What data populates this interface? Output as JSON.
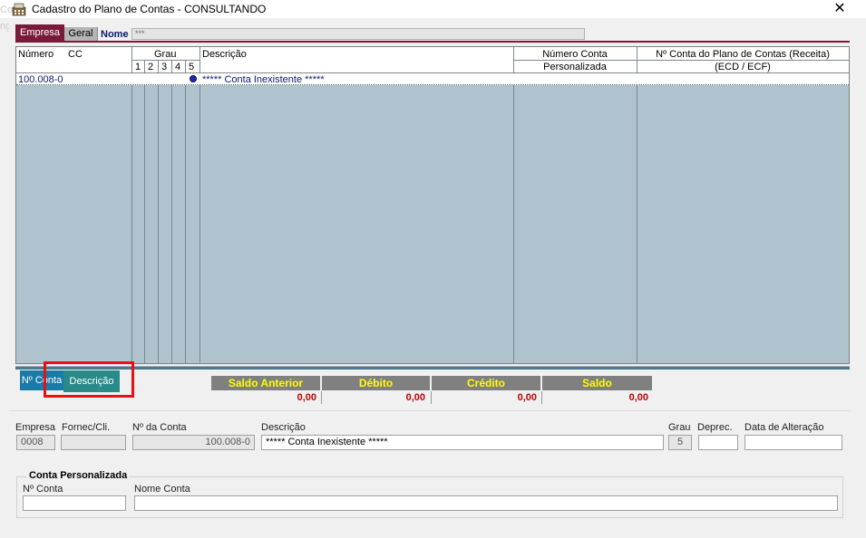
{
  "window": {
    "title": "Cadastro do Plano de Contas   -  CONSULTANDO",
    "close_glyph": "✕",
    "bg_text": "Co\nng"
  },
  "tabs": {
    "empresa": "Empresa",
    "geral": "Geral"
  },
  "nome": {
    "label": "Nome",
    "value": "***"
  },
  "grid": {
    "headers": {
      "numero": "Número",
      "cc": "CC",
      "grau": "Grau",
      "grau_levels": [
        "1",
        "2",
        "3",
        "4",
        "5"
      ],
      "descricao": "Descrição",
      "numero_conta_1": "Número Conta",
      "numero_conta_2": "Personalizada",
      "receita_1": "Nº Conta do Plano de Contas (Receita)",
      "receita_2": "(ECD / ECF)"
    },
    "rows": [
      {
        "numero": "100.008-0",
        "descricao": "***** Conta Inexistente *****"
      }
    ]
  },
  "bottom_tabs": {
    "nconta": "Nº Conta",
    "descricao": "Descrição"
  },
  "summary": {
    "saldo_anterior": {
      "label": "Saldo Anterior",
      "value": "0,00"
    },
    "debito": {
      "label": "Débito",
      "value": "0,00"
    },
    "credito": {
      "label": "Crédito",
      "value": "0,00"
    },
    "saldo": {
      "label": "Saldo",
      "value": "0,00"
    }
  },
  "form": {
    "empresa": {
      "label": "Empresa",
      "value": "0008"
    },
    "fornec": {
      "label": "Fornec/Cli.",
      "value": ""
    },
    "nconta": {
      "label": "Nº da Conta",
      "value": "100.008-0"
    },
    "descricao": {
      "label": "Descrição",
      "value": "***** Conta Inexistente *****"
    },
    "grau": {
      "label": "Grau",
      "value": "5"
    },
    "deprec": {
      "label": "Deprec.",
      "value": ""
    },
    "data_alteracao": {
      "label": "Data de Alteração",
      "value": ""
    }
  },
  "conta_personalizada": {
    "title": "Conta Personalizada",
    "nconta_label": "Nº Conta",
    "nome_label": "Nome Conta"
  },
  "colors": {
    "accent": "#7a1a3a",
    "grid_bg": "#aec3ce",
    "summary_header": "#808080",
    "summary_text": "#ffff00",
    "value_red": "#c00000",
    "highlight": "#e81010"
  }
}
